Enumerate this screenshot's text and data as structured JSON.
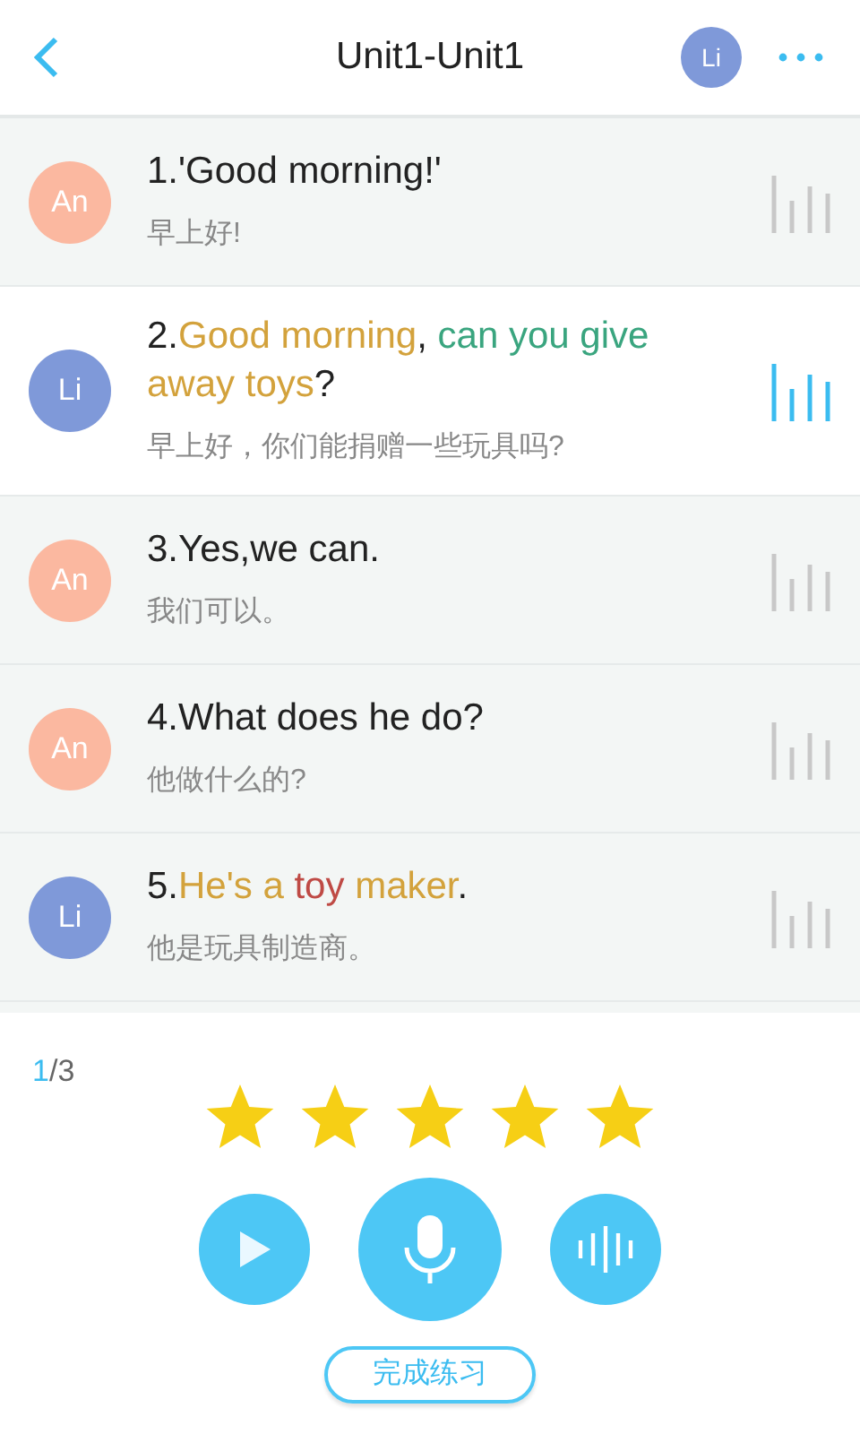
{
  "header": {
    "title": "Unit1-Unit1",
    "avatar": {
      "initials": "Li",
      "color": "#7f99d9"
    }
  },
  "dialogue": [
    {
      "speaker": "An",
      "color": "#fbb8a0",
      "selected": false,
      "segments": [
        {
          "text": "1.'Good morning!'",
          "color": "#222222"
        }
      ],
      "translation": "早上好!"
    },
    {
      "speaker": "Li",
      "color": "#7f99d9",
      "selected": true,
      "segments": [
        {
          "text": "2.",
          "color": "#222222"
        },
        {
          "text": "Good morning",
          "color": "#d3a23c"
        },
        {
          "text": ", ",
          "color": "#222222"
        },
        {
          "text": "can you give",
          "color": "#3aa57f"
        },
        {
          "text": " away toys",
          "color": "#d3a23c"
        },
        {
          "text": "?",
          "color": "#222222"
        }
      ],
      "translation": "早上好，你们能捐赠一些玩具吗?"
    },
    {
      "speaker": "An",
      "color": "#fbb8a0",
      "selected": false,
      "segments": [
        {
          "text": "3.Yes,we can.",
          "color": "#222222"
        }
      ],
      "translation": "我们可以。"
    },
    {
      "speaker": "An",
      "color": "#fbb8a0",
      "selected": false,
      "segments": [
        {
          "text": "4.What does he do?",
          "color": "#222222"
        }
      ],
      "translation": "他做什么的?"
    },
    {
      "speaker": "Li",
      "color": "#7f99d9",
      "selected": false,
      "segments": [
        {
          "text": "5.",
          "color": "#222222"
        },
        {
          "text": "He's a",
          "color": "#d3a23c"
        },
        {
          "text": " toy",
          "color": "#bf4a45"
        },
        {
          "text": " maker",
          "color": "#d3a23c"
        },
        {
          "text": ".",
          "color": "#222222"
        }
      ],
      "translation": "他是玩具制造商。"
    }
  ],
  "progress": {
    "current": "1",
    "rest": "/3"
  },
  "score": {
    "stars": 5
  },
  "finish_button": "完成练习"
}
